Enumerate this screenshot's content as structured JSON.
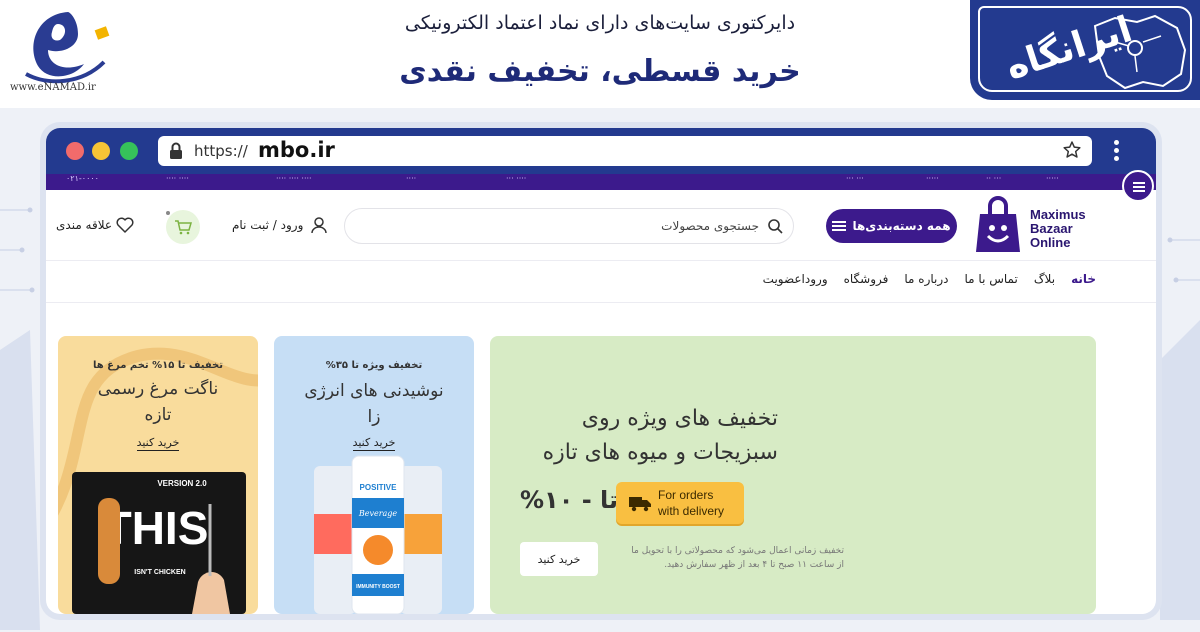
{
  "banner": {
    "enamad_url": "www.eNAMAD.ir",
    "directory_title": "دایرکتوری سایت‌های دارای نماد اعتماد الکترونیکی",
    "headline": "خرید قسطی، تخفیف نقدی",
    "iran_logo_text": "ایرانگاه"
  },
  "browser": {
    "url_prefix": "https://",
    "url_domain": "mbo.ir"
  },
  "site": {
    "brand_name": [
      "Maximus",
      "Bazaar",
      "Online"
    ],
    "categories_label": "همه دسته‌بندی‌ها",
    "search_placeholder": "جستجوی محصولات",
    "login_label": "ورود / ثبت نام",
    "wishlist_label": "علاقه مندی",
    "nav": [
      "خانه",
      "بلاگ",
      "تماس با ما",
      "درباره ما",
      "فروشگاه",
      "ورودا‌عضویت"
    ]
  },
  "promo_main": {
    "title_line1": "تخفیف های ویژه روی",
    "title_line2": "سبزیجات و میوه های تازه",
    "discount": "تا - ۱۰%",
    "delivery_line1": "For orders",
    "delivery_line2": "with delivery",
    "note_line1": "تخفیف زمانی اعمال می‌شود که محصولاتی را با تحویل ما",
    "note_line2": "از ساعت ۱۱ صبح تا ۴ بعد از ظهر سفارش دهید.",
    "buy_label": "خرید کنید"
  },
  "promo_drinks": {
    "tag": "تخفیف ویژه تا ۳۵%",
    "title_line1": "نوشیدنی های انرژی",
    "title_line2": "زا",
    "buy_label": "خرید کنید",
    "can_brand": "POSITIVE",
    "can_sub": "Beverage",
    "can_tag": "IMMUNITY BOOST"
  },
  "promo_nuggets": {
    "tag": "تخفیف تا ۱۵% تخم مرغ ها",
    "title_line1": "ناگت مرغ رسمی",
    "title_line2": "تازه",
    "buy_label": "خرید کنید",
    "pack_version": "VERSION 2.0",
    "pack_big": "THIS",
    "pack_sub": "ISN'T CHICKEN"
  },
  "colors": {
    "brand_purple": "#3c1a8c",
    "banner_blue": "#233a8f",
    "green_card": "#d7ebc5",
    "blue_card": "#c6def5",
    "yellow_card": "#f9dc9c",
    "delivery_badge": "#f9bf41"
  }
}
